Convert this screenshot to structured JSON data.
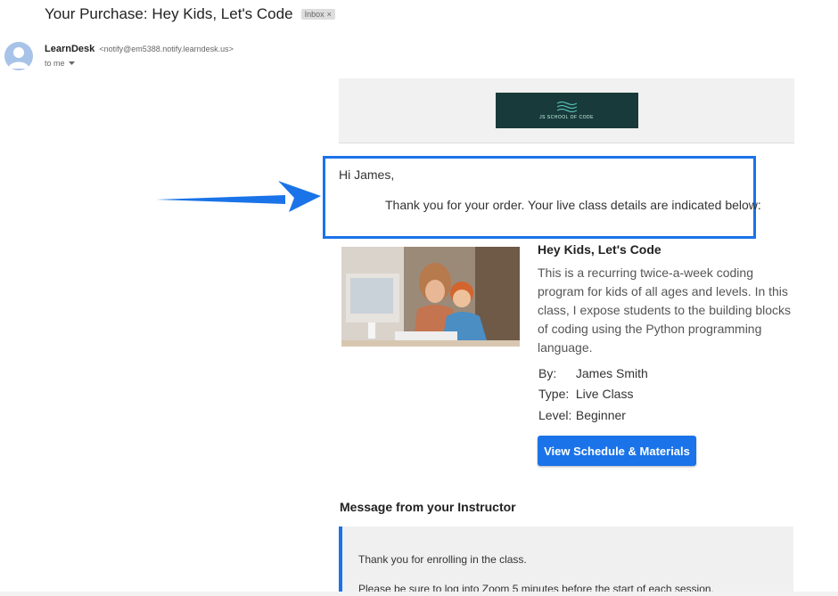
{
  "email": {
    "subject": "Your Purchase: Hey Kids, Let's Code",
    "label": "Inbox",
    "label_remove": "×",
    "sender_name": "LearnDesk",
    "sender_email": "<notify@em5388.notify.learndesk.us>",
    "recipient": "to me"
  },
  "banner": {
    "logo_text": "JS SCHOOL OF CODE"
  },
  "body": {
    "greeting": "Hi James,",
    "thanks": "Thank you for your order. Your live class details are indicated below:"
  },
  "course": {
    "title": "Hey Kids, Let's Code",
    "description": "This is a recurring twice-a-week coding program for kids of all ages and levels. In this class, I expose students to the building blocks of coding using the Python programming language.",
    "by_label": "By:",
    "by_value": "James Smith",
    "type_label": "Type:",
    "type_value": "Live Class",
    "level_label": "Level:",
    "level_value": "Beginner",
    "button_label": "View Schedule & Materials"
  },
  "instructor_message": {
    "heading": "Message from your Instructor",
    "line1": "Thank you for enrolling in the class.",
    "line2": "Please be sure to log into Zoom 5 minutes before the start of each session."
  },
  "colors": {
    "accent": "#1a73e8",
    "logo_bg": "#193a3a"
  }
}
